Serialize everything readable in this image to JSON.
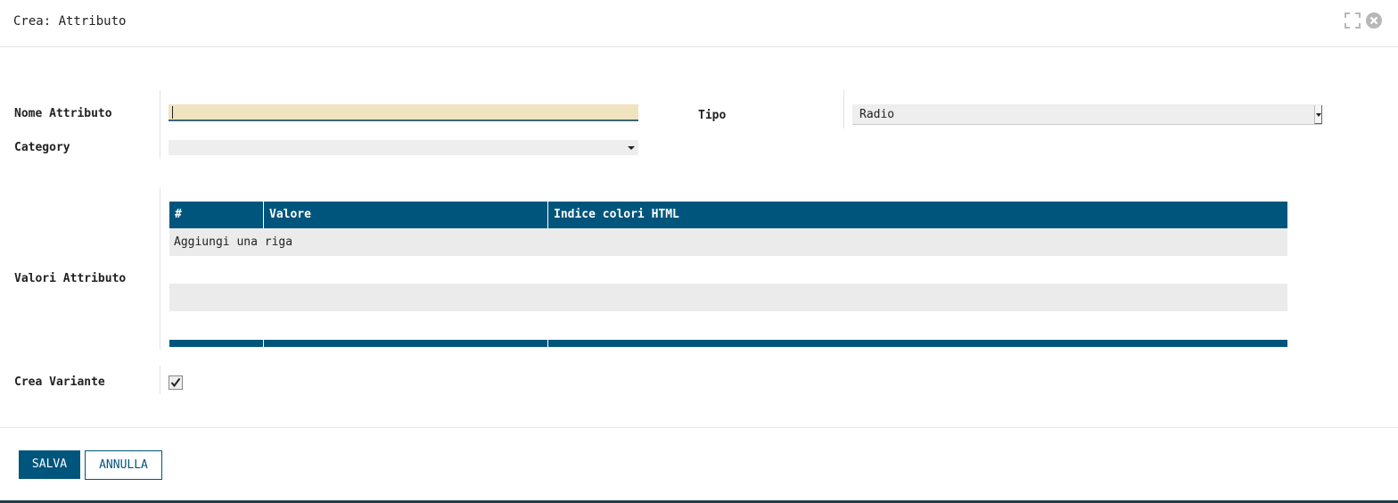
{
  "dialog": {
    "title": "Crea: Attributo"
  },
  "form": {
    "name_label": "Nome Attributo",
    "name_value": "",
    "category_label": "Category",
    "category_value": "",
    "tipo_label": "Tipo",
    "tipo_value": "Radio",
    "values_label": "Valori Attributo",
    "variant_label": "Crea Variante",
    "variant_checked": true
  },
  "grid": {
    "columns": [
      "#",
      "Valore",
      "Indice colori HTML"
    ],
    "add_row_label": "Aggiungi una riga"
  },
  "buttons": {
    "save": "SALVA",
    "cancel": "ANNULLA"
  },
  "colors": {
    "primary": "#00557c",
    "input_focus": "#f0e3c0"
  },
  "icons": [
    "expand-icon",
    "close-icon",
    "chevron-down-icon",
    "checkmark-icon"
  ]
}
